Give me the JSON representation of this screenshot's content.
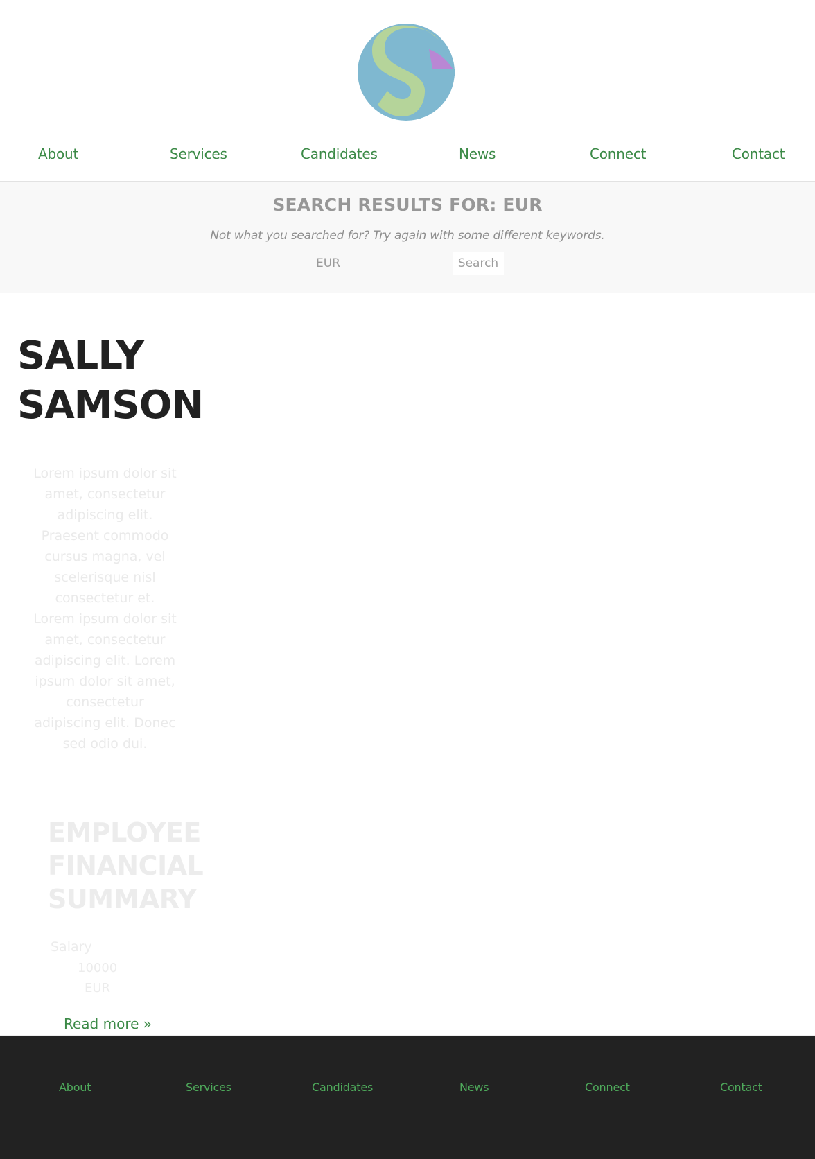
{
  "header": {
    "logo_icon": "sg-circle-logo",
    "logo_colors": {
      "blue": "#7fb8d0",
      "green": "#b5d49a",
      "purple": "#b987d4"
    }
  },
  "nav": {
    "items": [
      {
        "label": "About"
      },
      {
        "label": "Services"
      },
      {
        "label": "Candidates"
      },
      {
        "label": "News"
      },
      {
        "label": "Connect"
      },
      {
        "label": "Contact"
      }
    ]
  },
  "search": {
    "title": "SEARCH RESULTS FOR: EUR",
    "hint": "Not what you searched for? Try again with some different keywords.",
    "input_value": "EUR",
    "button_label": "Search"
  },
  "result": {
    "name_line1": "SALLY",
    "name_line2": "SAMSON",
    "bio": "Lorem ipsum dolor sit amet, consectetur adipiscing elit. Praesent commodo cursus magna, vel scelerisque nisl consectetur et. Lorem ipsum dolor sit amet, consectetur adipiscing elit. Lorem ipsum dolor sit amet, consectetur adipiscing elit. Donec sed odio dui.",
    "section_title_line1": "EMPLOYEE",
    "section_title_line2": "FINANCIAL",
    "section_title_line3": "SUMMARY",
    "salary_label": "Salary",
    "salary_value": "10000",
    "salary_currency": "EUR",
    "read_more": "Read more »"
  },
  "footer": {
    "items": [
      {
        "label": "About"
      },
      {
        "label": "Services"
      },
      {
        "label": "Candidates"
      },
      {
        "label": "News"
      },
      {
        "label": "Connect"
      },
      {
        "label": "Contact"
      }
    ]
  },
  "colors": {
    "accent": "#3c8a47",
    "footer_bg": "#222222",
    "footer_link": "#4ea95b",
    "band_bg": "#f8f8f8"
  }
}
